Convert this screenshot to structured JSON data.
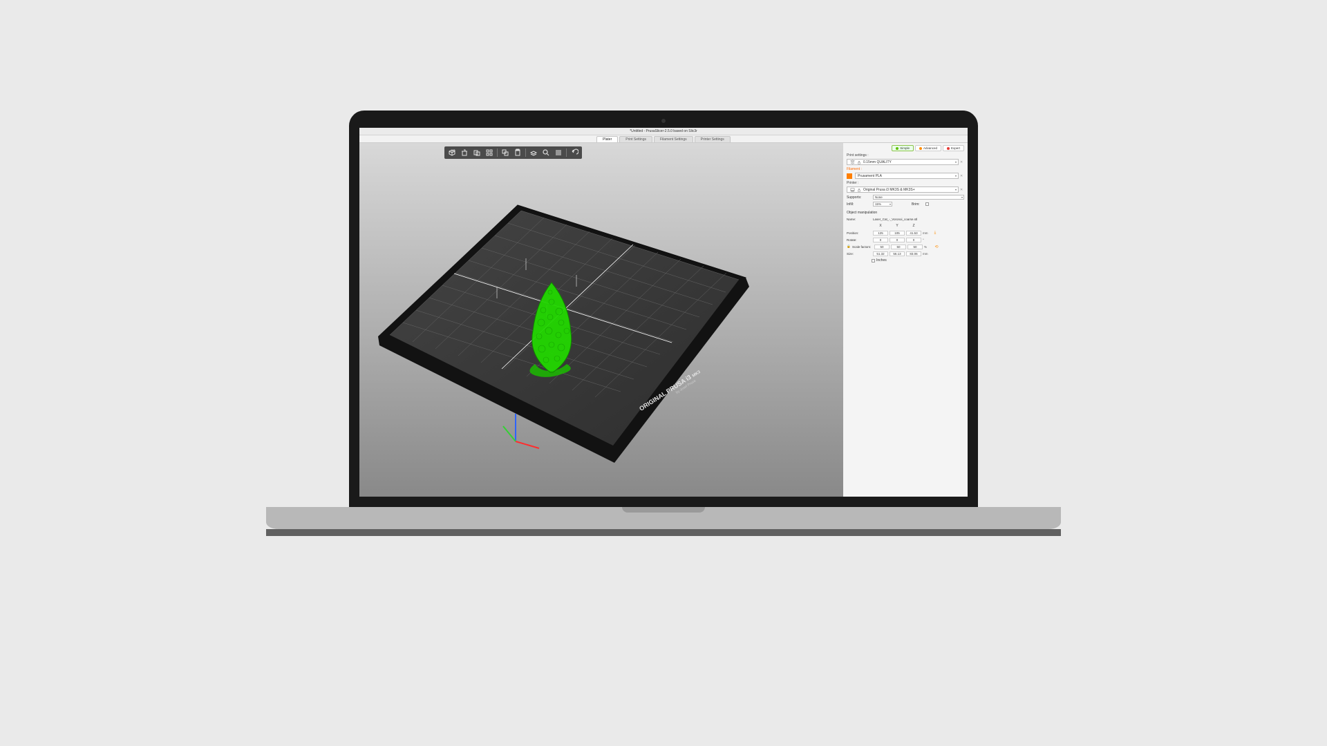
{
  "title": "*Untitled - PrusaSlicer-2.5.0 based on Slic3r",
  "tabs": {
    "plater": "Plater",
    "print": "Print Settings",
    "filament": "Filament Settings",
    "printer": "Printer Settings"
  },
  "modes": {
    "simple": "Simple",
    "advanced": "Advanced",
    "expert": "Expert"
  },
  "panel": {
    "printSettingsLabel": "Print settings :",
    "printSettingsValue": "0.15mm QUALITY",
    "filamentLabel": "Filament :",
    "filamentValue": "Prusament PLA",
    "printerLabel": "Printer :",
    "printerValue": "Original Prusa i3 MK3S & MK3S+",
    "supportsLabel": "Supports:",
    "supportsValue": "None",
    "infillLabel": "Infill:",
    "infillValue": "15%",
    "brimLabel": "Brim:"
  },
  "obj": {
    "heading": "Object manipulation",
    "nameLabel": "Name:",
    "nameValue": "Laser_Cat_-_Voronoi_coarse.stl",
    "cols": {
      "x": "X",
      "y": "Y",
      "z": "Z"
    },
    "position": {
      "label": "Position:",
      "x": "125",
      "y": "105",
      "z": "41.53",
      "unit": "mm"
    },
    "rotate": {
      "label": "Rotate:",
      "x": "0",
      "y": "0",
      "z": "0",
      "unit": "°"
    },
    "scale": {
      "label": "Scale factors:",
      "x": "50",
      "y": "50",
      "z": "50",
      "unit": "%"
    },
    "size": {
      "label": "Size:",
      "x": "51.32",
      "y": "56.13",
      "z": "83.06",
      "unit": "mm"
    },
    "inches": "Inches"
  },
  "bed": {
    "line1": "ORIGINAL PRUSA i3",
    "line1b": "MK3",
    "line2": "by Josef Prusa"
  },
  "colors": {
    "green": "#5fbf00",
    "orange": "#ff8c00",
    "red": "#e53935"
  }
}
